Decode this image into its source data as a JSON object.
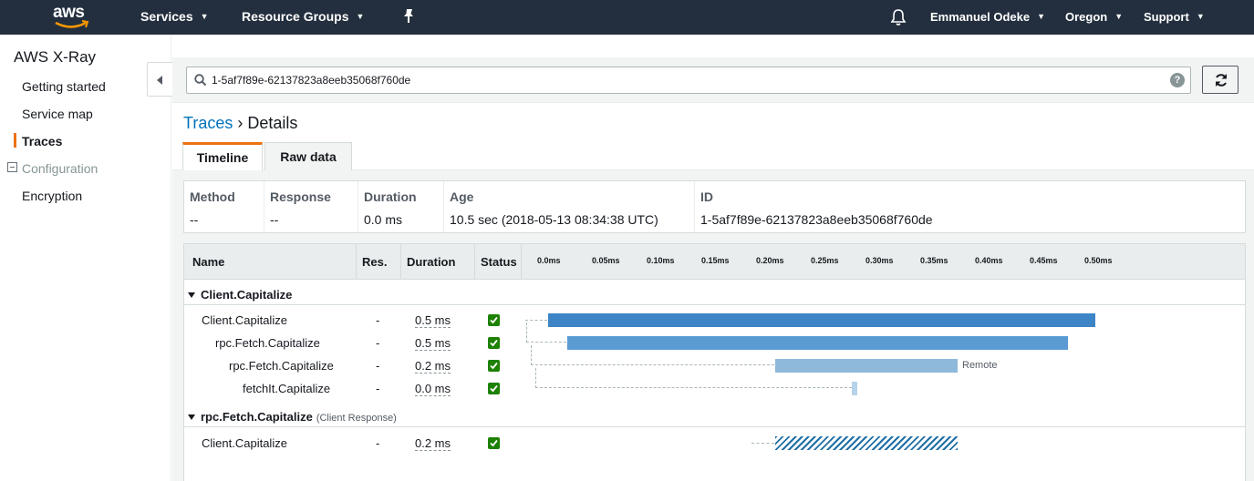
{
  "topnav": {
    "logo": "aws",
    "services": "Services",
    "resource_groups": "Resource Groups",
    "user": "Emmanuel Odeke",
    "region": "Oregon",
    "support": "Support"
  },
  "sidebar": {
    "title": "AWS X-Ray",
    "items": [
      {
        "label": "Getting started"
      },
      {
        "label": "Service map"
      },
      {
        "label": "Traces"
      },
      {
        "label": "Configuration"
      },
      {
        "label": "Encryption"
      }
    ]
  },
  "search": {
    "value": "1-5af7f89e-62137823a8eeb35068f760de",
    "help": "?"
  },
  "breadcrumb": {
    "parent": "Traces",
    "separator": " › ",
    "current": "Details"
  },
  "tabs": [
    {
      "label": "Timeline"
    },
    {
      "label": "Raw data"
    }
  ],
  "summary": {
    "headers": [
      "Method",
      "Response",
      "Duration",
      "Age",
      "ID"
    ],
    "values": [
      "--",
      "--",
      "0.0 ms",
      "10.5 sec (2018-05-13 08:34:38 UTC)",
      "1-5af7f89e-62137823a8eeb35068f760de"
    ]
  },
  "timeline": {
    "headers": {
      "name": "Name",
      "res": "Res.",
      "duration": "Duration",
      "status": "Status"
    },
    "ticks": [
      "0.0ms",
      "0.05ms",
      "0.10ms",
      "0.15ms",
      "0.20ms",
      "0.25ms",
      "0.30ms",
      "0.35ms",
      "0.40ms",
      "0.45ms",
      "0.50ms"
    ],
    "groups": [
      {
        "name": "Client.Capitalize",
        "sub": "",
        "rows": [
          {
            "name": "Client.Capitalize",
            "res": "-",
            "duration": "0.5 ms",
            "label": ""
          },
          {
            "name": "rpc.Fetch.Capitalize",
            "res": "-",
            "duration": "0.5 ms",
            "label": ""
          },
          {
            "name": "rpc.Fetch.Capitalize",
            "res": "-",
            "duration": "0.2 ms",
            "label": "Remote"
          },
          {
            "name": "fetchIt.Capitalize",
            "res": "-",
            "duration": "0.0 ms",
            "label": ""
          }
        ]
      },
      {
        "name": "rpc.Fetch.Capitalize",
        "sub": "(Client Response)",
        "rows": [
          {
            "name": "Client.Capitalize",
            "res": "-",
            "duration": "0.2 ms",
            "label": ""
          }
        ]
      }
    ]
  },
  "colors": {
    "topnav": "#232f3e",
    "accent": "#ec7211",
    "link": "#0073bb",
    "bar_root": "#3d85c6",
    "bar_child": "#5a9bd4",
    "bar_remote": "#8eb9db",
    "status_ok": "#1d8102"
  }
}
